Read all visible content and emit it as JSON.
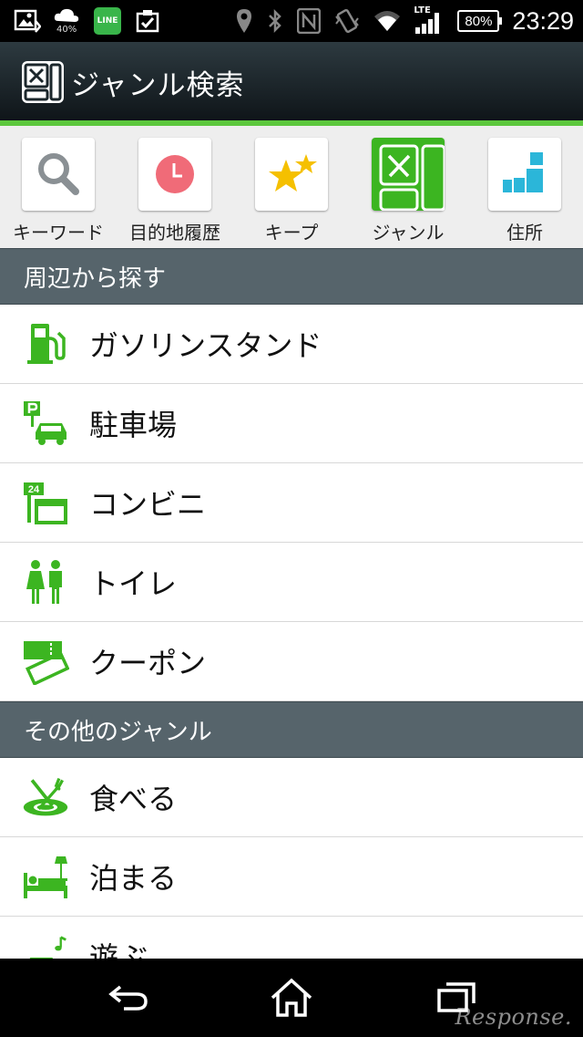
{
  "status_bar": {
    "weather_percent": "40%",
    "line_badge": "LINE",
    "network_type": "LTE",
    "battery": "80%",
    "time": "23:29",
    "icons": [
      "gallery-icon",
      "weather-icon",
      "line-app-icon",
      "clipboard-check-icon",
      "location-icon",
      "bluetooth-icon",
      "nfc-icon",
      "vibrate-icon",
      "wifi-icon",
      "signal-icon",
      "battery-icon"
    ]
  },
  "action_bar": {
    "title": "ジャンル検索",
    "icon": "genre-app-icon"
  },
  "colors": {
    "accent": "#5cc73d",
    "icon_green": "#3cb521",
    "section_header": "#56646b",
    "address_cyan": "#2bb6d9",
    "star": "#f5c000",
    "history": "#f06b78"
  },
  "tabs": [
    {
      "label": "キーワード",
      "icon": "search-icon",
      "active": false
    },
    {
      "label": "目的地履歴",
      "icon": "clock-icon",
      "active": false
    },
    {
      "label": "キープ",
      "icon": "stars-icon",
      "active": false
    },
    {
      "label": "ジャンル",
      "icon": "genre-icon",
      "active": true
    },
    {
      "label": "住所",
      "icon": "address-blocks-icon",
      "active": false
    }
  ],
  "sections": [
    {
      "title": "周辺から探す",
      "items": [
        {
          "label": "ガソリンスタンド",
          "icon": "gas-pump-icon"
        },
        {
          "label": "駐車場",
          "icon": "parking-car-icon"
        },
        {
          "label": "コンビニ",
          "icon": "convenience-store-icon"
        },
        {
          "label": "トイレ",
          "icon": "restroom-icon"
        },
        {
          "label": "クーポン",
          "icon": "coupon-icon"
        }
      ]
    },
    {
      "title": "その他のジャンル",
      "items": [
        {
          "label": "食べる",
          "icon": "fork-knife-icon"
        },
        {
          "label": "泊まる",
          "icon": "bed-lamp-icon"
        },
        {
          "label": "遊ぶ",
          "icon": "car-music-icon"
        }
      ]
    }
  ],
  "nav_bar": {
    "icons": [
      "back-icon",
      "home-icon",
      "recent-apps-icon"
    ]
  },
  "watermark": "Response."
}
